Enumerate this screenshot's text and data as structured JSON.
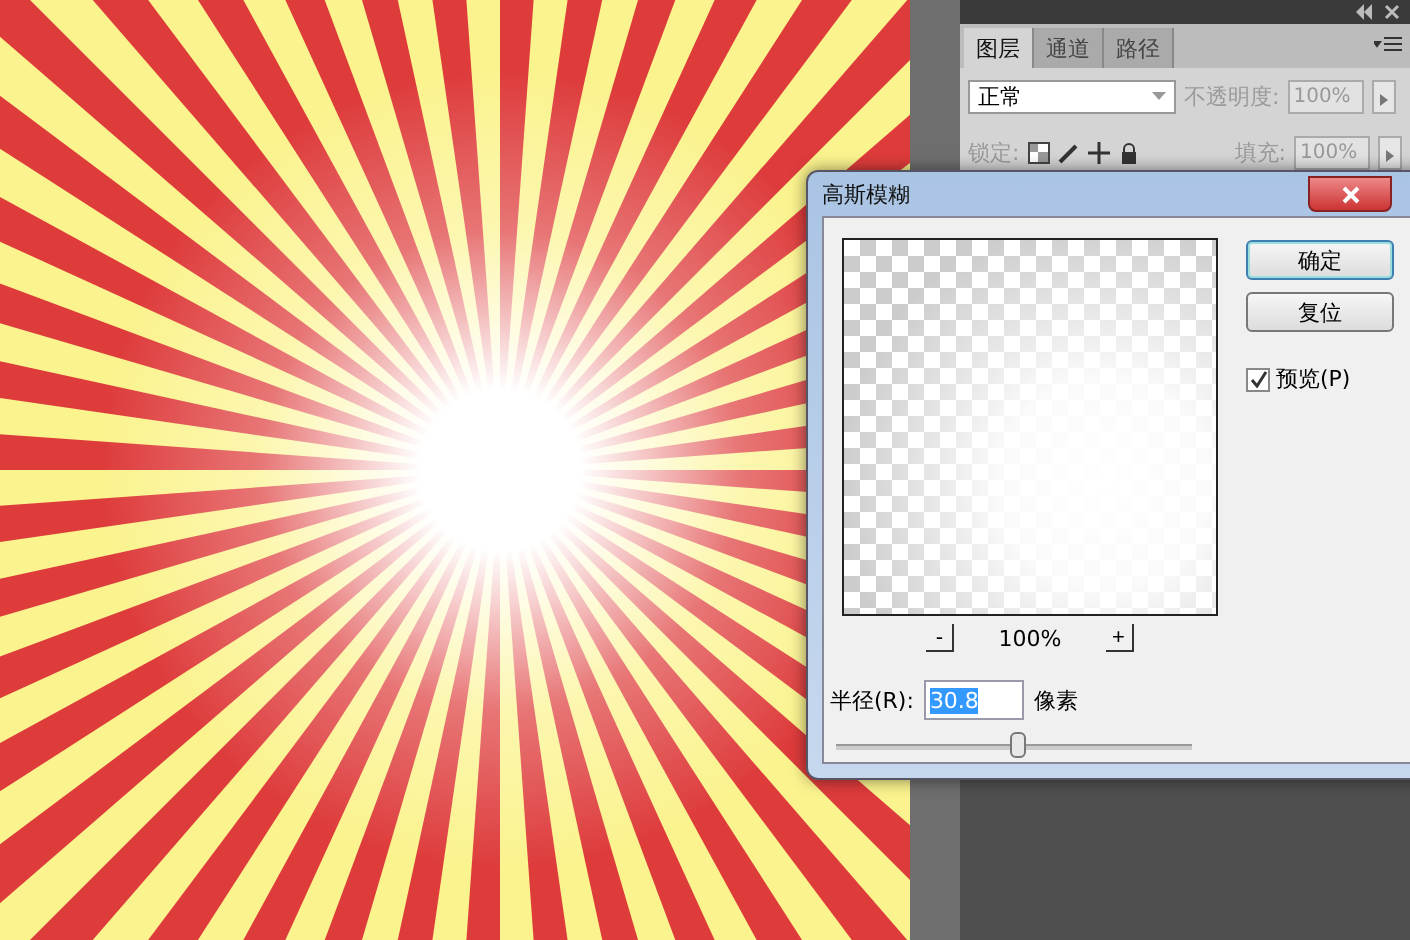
{
  "panel": {
    "tabs": [
      {
        "label": "图层",
        "selected": true
      },
      {
        "label": "通道",
        "selected": false
      },
      {
        "label": "路径",
        "selected": false
      }
    ],
    "blend_mode": "正常",
    "opacity_label": "不透明度:",
    "opacity": "100%",
    "lock_label": "锁定:",
    "fill_label": "填充:",
    "fill": "100%"
  },
  "dialog": {
    "title": "高斯模糊",
    "buttons": [
      "确定",
      "复位"
    ],
    "preview": {
      "label": "预览(P)",
      "checked": true
    },
    "zoom": {
      "minus": "-",
      "value": "100%",
      "plus": "+"
    },
    "radius": {
      "label": "半径(R):",
      "value": "30.8",
      "unit": "像素",
      "level": 0.51
    }
  }
}
